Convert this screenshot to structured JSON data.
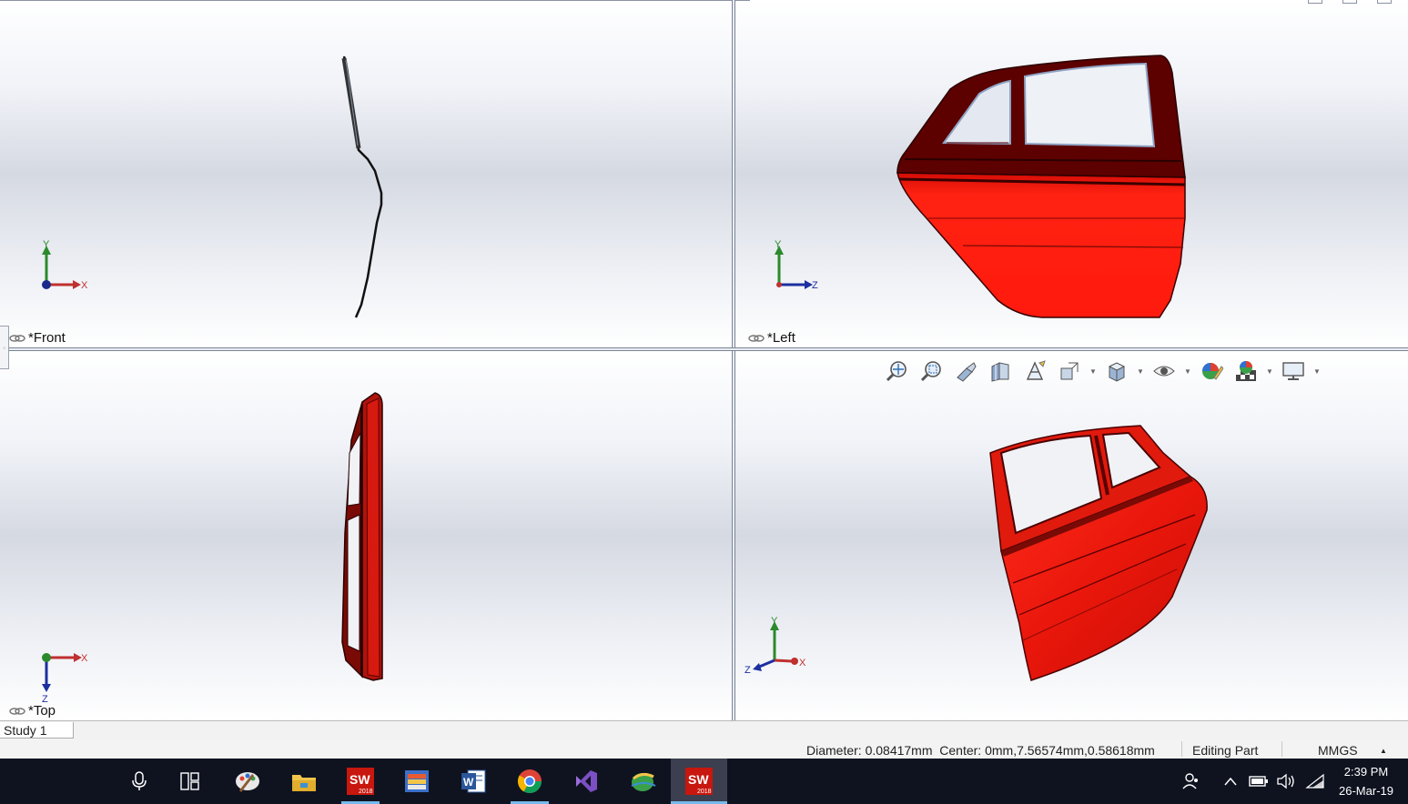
{
  "viewports": {
    "front": {
      "label": "*Front",
      "axes": {
        "vertical": "Y",
        "horizontal": "X"
      }
    },
    "left": {
      "label": "*Left",
      "axes": {
        "vertical": "Y",
        "horizontal": "Z"
      }
    },
    "top": {
      "label": "*Top",
      "axes": {
        "horizontal": "X",
        "down": "Z"
      }
    },
    "iso": {
      "axes": {
        "vertical": "Y",
        "horizontal": "X",
        "depth": "Z"
      }
    }
  },
  "heads_up_toolbar": {
    "icons": [
      "zoom-to-fit-icon",
      "zoom-to-area-icon",
      "previous-view-icon",
      "section-view-icon",
      "dynamic-annotation-icon",
      "view-orientation-icon",
      "display-style-icon",
      "hide-show-items-icon",
      "edit-appearance-icon",
      "apply-scene-icon",
      "view-settings-icon"
    ]
  },
  "tabs": {
    "study": "Study 1"
  },
  "status_bar": {
    "measurement": "Diameter: 0.08417mm  Center: 0mm,7.56574mm,0.58618mm",
    "mode": "Editing Part",
    "units": "MMGS",
    "units_arrow": "▲"
  },
  "taskbar": {
    "apps": [
      {
        "name": "microphone-icon"
      },
      {
        "name": "task-view-icon"
      },
      {
        "name": "paint-app-icon"
      },
      {
        "name": "file-explorer-icon"
      },
      {
        "name": "solidworks-2018-icon",
        "label": "2018"
      },
      {
        "name": "books-app-icon"
      },
      {
        "name": "word-icon",
        "label": "W"
      },
      {
        "name": "chrome-icon"
      },
      {
        "name": "visual-studio-icon"
      },
      {
        "name": "globe-app-icon"
      },
      {
        "name": "solidworks-2018-active-icon",
        "label": "2018"
      }
    ],
    "clock": {
      "time": "2:39 PM",
      "date": "26-Mar-19"
    }
  },
  "colors": {
    "part_red": "#ff1a0d",
    "part_dark": "#5c0000",
    "taskbar": "#0f1320",
    "accent": "#76b9ed"
  }
}
